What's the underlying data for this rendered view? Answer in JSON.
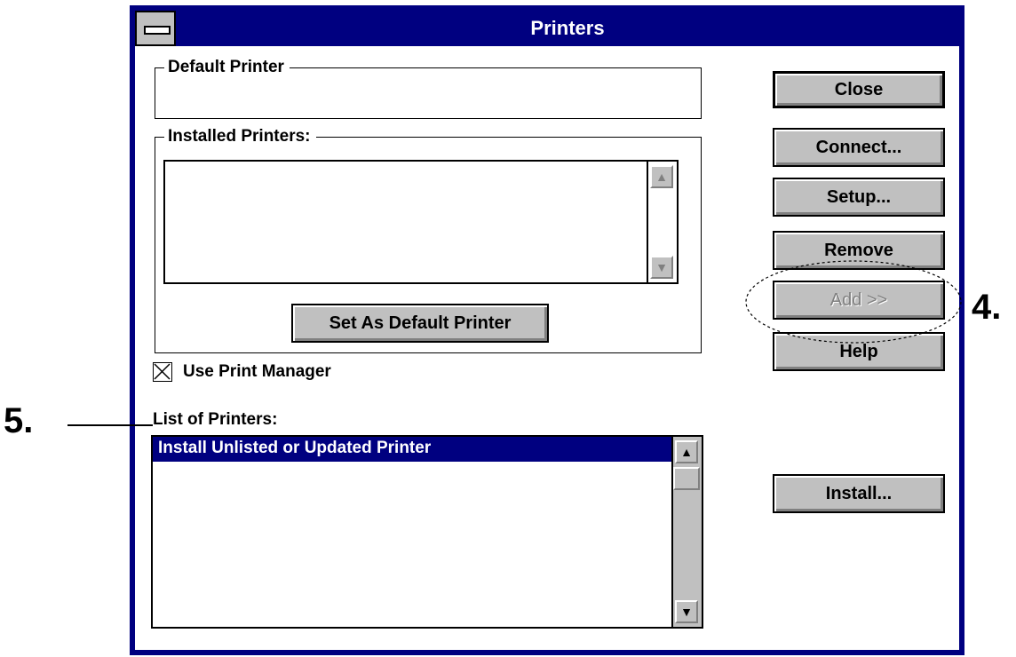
{
  "window": {
    "title": "Printers"
  },
  "default_printer": {
    "label": "Default Printer",
    "value": ""
  },
  "installed_printers": {
    "label": "Installed Printers:",
    "items": []
  },
  "buttons": {
    "set_default": "Set As Default Printer",
    "close": "Close",
    "connect": "Connect...",
    "setup": "Setup...",
    "remove": "Remove",
    "add": "Add >>",
    "help": "Help",
    "install": "Install..."
  },
  "print_manager": {
    "label": "Use Print Manager",
    "checked": true
  },
  "list_of_printers": {
    "label": "List of Printers:",
    "selected": "Install Unlisted or Updated Printer"
  },
  "annotations": {
    "callout_4": "4.",
    "callout_5": "5."
  },
  "colors": {
    "title_bar": "#000080",
    "button_face": "#c0c0c0",
    "selection": "#000080"
  }
}
